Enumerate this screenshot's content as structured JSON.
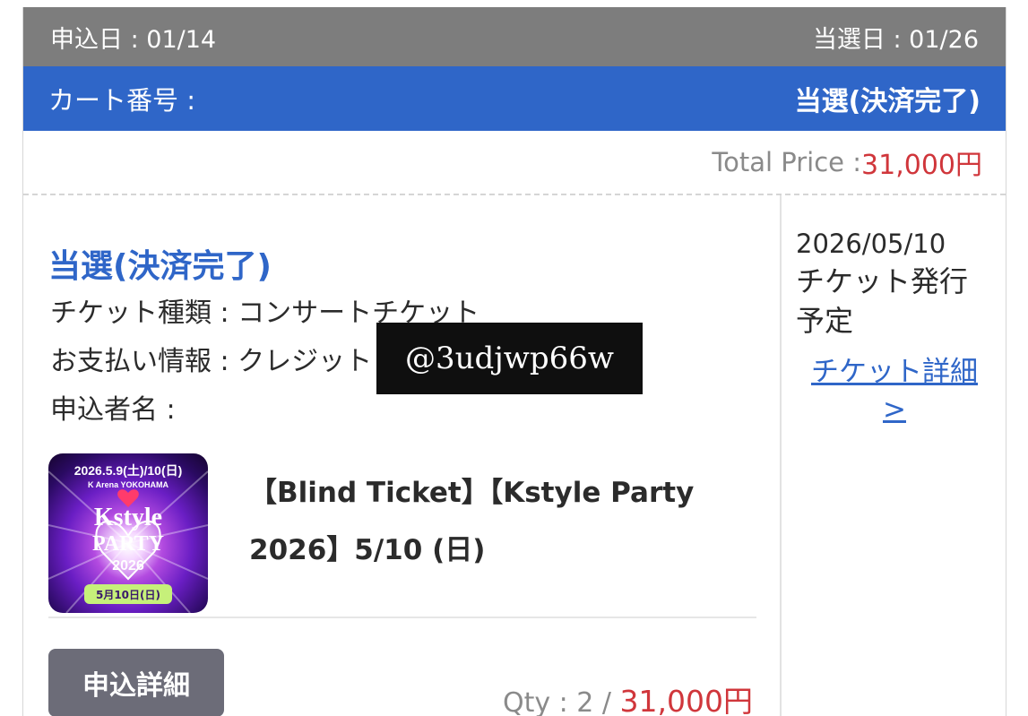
{
  "header": {
    "applied_date": "申込日 : 01/14",
    "result_date": "当選日 : 01/26",
    "cart_label": "カート番号 :",
    "status": "当選(決済完了)"
  },
  "total": {
    "label": "Total Price : ",
    "value": "31,000円"
  },
  "order": {
    "status": "当選(決済完了)",
    "ticket_type": "チケット種類 : コンサートチケット",
    "payment_info": "お支払い情報 : クレジット",
    "applicant_name": "申込者名 :",
    "event_title": "【Blind Ticket】【Kstyle Party 2026】5/10 (日)",
    "detail_button": "申込詳細",
    "qty_label": "Qty : 2 / ",
    "qty_price": "31,000円"
  },
  "thumbnail": {
    "date_text": "2026.5.9(土)/10(日)",
    "venue": "K Arena YOKOHAMA",
    "title": "Kstyle",
    "party": "PARTY",
    "year": "2026",
    "day_badge": "5月10日(日)"
  },
  "issuance": {
    "date": "2026/05/10",
    "text": "チケット発行予定",
    "link": "チケット詳細 >"
  },
  "watermark": "@3udjwp66w",
  "colors": {
    "header_gray": "#7d7d7d",
    "accent_blue": "#2f66c8",
    "price_red": "#d0363b",
    "button_gray": "#6c6c78"
  }
}
